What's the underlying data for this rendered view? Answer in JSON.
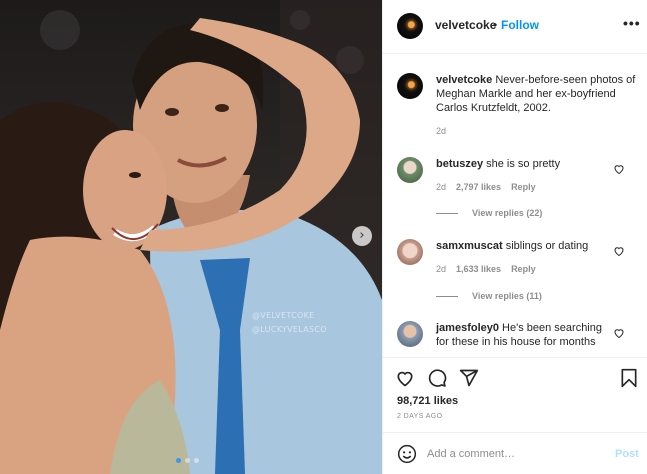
{
  "post": {
    "username": "velvetcoke",
    "separator": "•",
    "follow_label": "Follow",
    "more_label": "•••",
    "caption_text": "Never-before-seen photos of Meghan Markle and her ex-boyfriend Carlos Krutzfeldt, 2002.",
    "caption_time": "2d",
    "likes": "98,721 likes",
    "posted": "2 DAYS AGO",
    "watermark_lines": [
      "@VELVETCOKE",
      "@LUCKYVELASCO"
    ],
    "carousel": {
      "total": 3,
      "active_index": 0
    }
  },
  "comments": [
    {
      "username": "betuszey",
      "text": "she is so pretty",
      "time": "2d",
      "likes": "2,797 likes",
      "reply": "Reply",
      "view_replies": "View replies (22)",
      "avatar_color": "#6f8c6a"
    },
    {
      "username": "samxmuscat",
      "text": "siblings or dating",
      "time": "2d",
      "likes": "1,633 likes",
      "reply": "Reply",
      "view_replies": "View replies (11)",
      "avatar_color": "#c79a8a"
    },
    {
      "username": "jamesfoley0",
      "text": "He's been searching for these in his house for months",
      "avatar_color": "#8a9bb0"
    }
  ],
  "comment_box": {
    "placeholder": "Add a comment…",
    "post_label": "Post"
  },
  "icons": [
    "heart-icon",
    "comment-icon",
    "share-icon",
    "bookmark-icon",
    "emoji-icon",
    "chevron-right-icon",
    "more-icon"
  ],
  "colors": {
    "link": "#0095f6",
    "post_disabled": "#b2dffc",
    "muted": "#8e8e8e",
    "text": "#262626"
  }
}
